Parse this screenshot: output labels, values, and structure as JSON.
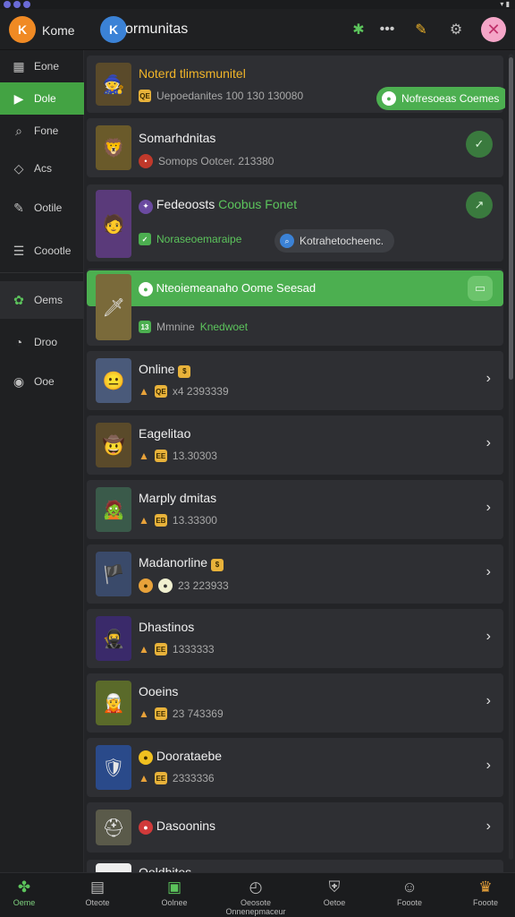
{
  "colors": {
    "accent": "#4caf50",
    "background": "#232427",
    "card": "#2e2f33"
  },
  "header": {
    "home_label": "Kome",
    "app_title": "ormunitas",
    "icons": [
      "star-icon",
      "more-icon",
      "notification-icon",
      "settings-icon",
      "close-icon"
    ]
  },
  "sidebar": {
    "items": [
      {
        "label": "Eone",
        "icon": "grid-icon"
      },
      {
        "label": "Dole",
        "icon": "play-icon"
      },
      {
        "label": "Fone",
        "icon": "search-icon"
      },
      {
        "label": "Acs",
        "icon": "tag-icon"
      },
      {
        "label": "Ootile",
        "icon": "pencil-icon"
      },
      {
        "label": "Coootle",
        "icon": "list-icon"
      },
      {
        "label": "Oems",
        "icon": "games-icon"
      },
      {
        "label": "Droo",
        "icon": "clock-icon"
      },
      {
        "label": "Ooe",
        "icon": "circle-icon"
      }
    ]
  },
  "cards": {
    "featured1": {
      "title": "Noterd tlimsmunitel",
      "meta": "Uepoedanites 100 130 130080",
      "badge": "QE",
      "button": "Nofresoeas Coemes"
    },
    "featured2": {
      "title": "Somarhdnitas",
      "meta": "Somops Ootcer. 213380"
    },
    "featured3": {
      "title": "Fedeoosts",
      "title_accent": "Coobus Fonet",
      "tag_green": "Noraseoemaraipe",
      "tag_gray": "Kotrahetocheenc."
    },
    "featured4": {
      "band_text": "Nteoiemeanaho Oome Seesad",
      "label": "Mmnine",
      "label_accent": "Knedwoet",
      "badge": "13"
    },
    "rows": [
      {
        "title": "Online",
        "meta": "x4 2393339",
        "badge": "QE"
      },
      {
        "title": "Eagelitao",
        "meta": "13.30303",
        "badge": "EE"
      },
      {
        "title": "Marply dmitas",
        "meta": "13.33300",
        "badge": "EB"
      },
      {
        "title": "Madanorline",
        "meta": "23 223933",
        "badge": ""
      },
      {
        "title": "Dhastinos",
        "meta": "1333333",
        "badge": "EE"
      },
      {
        "title": "Ooeins",
        "meta": "23 743369",
        "badge": "EE"
      },
      {
        "title": "Doorataebe",
        "meta": "2333336",
        "badge": "EE"
      },
      {
        "title": "Dasoonins",
        "meta": "",
        "badge": ""
      }
    ],
    "partial": {
      "title": "Ooldhites"
    }
  },
  "bottom_nav": [
    {
      "label": "Oeme",
      "icon": "clover-icon"
    },
    {
      "label": "Oteote",
      "icon": "calendar-icon"
    },
    {
      "label": "Oolnee",
      "icon": "image-icon"
    },
    {
      "label": "Oeosote Onnenepmaceur",
      "icon": "speedometer-icon"
    },
    {
      "label": "Oetoe",
      "icon": "shield-icon"
    },
    {
      "label": "Fooote",
      "icon": "controller-icon"
    },
    {
      "label": "Fooote",
      "icon": "trophy-icon"
    }
  ]
}
